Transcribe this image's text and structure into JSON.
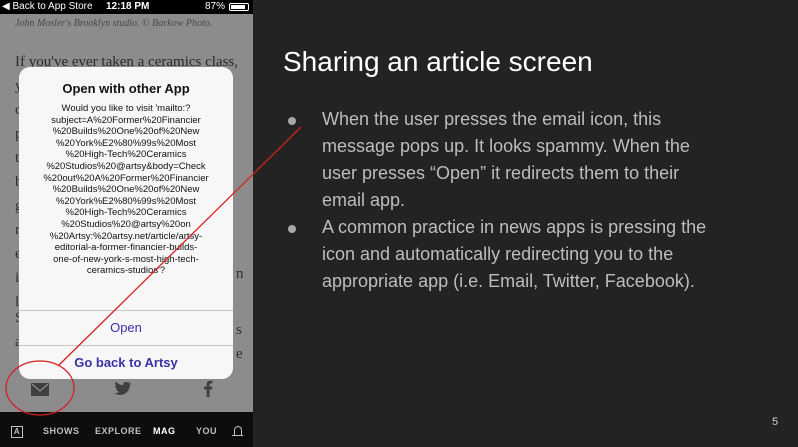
{
  "status_bar": {
    "back_label": "◀ Back to App Store",
    "time": "12:18 PM",
    "battery": "87%"
  },
  "article": {
    "caption": "John Mosler's Brooklyn studio. © Barkow Photo.",
    "intro": "If you've ever taken a ceramics class,"
  },
  "dialog": {
    "title": "Open with other App",
    "message_lines": [
      "Would you like to visit 'mailto:?",
      "subject=A%20Former%20Financier",
      "%20Builds%20One%20of%20New",
      "%20York%E2%80%99s%20Most",
      "%20High-Tech%20Ceramics",
      "%20Studios%20@artsy&body=Check",
      "%20out%20A%20Former%20Financier",
      "%20Builds%20One%20of%20New",
      "%20York%E2%80%99s%20Most",
      "%20High-Tech%20Ceramics",
      "%20Studios%20@artsy%20on",
      "%20Artsy:%20artsy.net/article/artsy-",
      "editorial-a-former-financier-builds-",
      "one-of-new-york-s-most-high-tech-",
      "ceramics-studios'?"
    ],
    "open_label": "Open",
    "back_label": "Go back to Artsy"
  },
  "share_icons": [
    "envelope-icon",
    "twitter-icon",
    "facebook-icon"
  ],
  "nav": {
    "logo": "A",
    "items": [
      "SHOWS",
      "EXPLORE",
      "MAG",
      "YOU"
    ],
    "active": "MAG"
  },
  "slide": {
    "title": "Sharing an article screen",
    "bullets": [
      {
        "lines": [
          "When the user presses the email icon, this",
          "message pops up. It looks spammy. When the",
          "user presses “Open” it redirects them to their",
          "email app."
        ]
      },
      {
        "lines": [
          "A common practice in news apps is pressing the",
          "icon and automatically redirecting you to the",
          "appropriate app (i.e. Email, Twitter, Facebook)."
        ]
      }
    ],
    "page_number": "5"
  },
  "colors": {
    "slide_bg": "#232323",
    "dialog_button": "#3a32a6",
    "annotation": "#d42020"
  }
}
